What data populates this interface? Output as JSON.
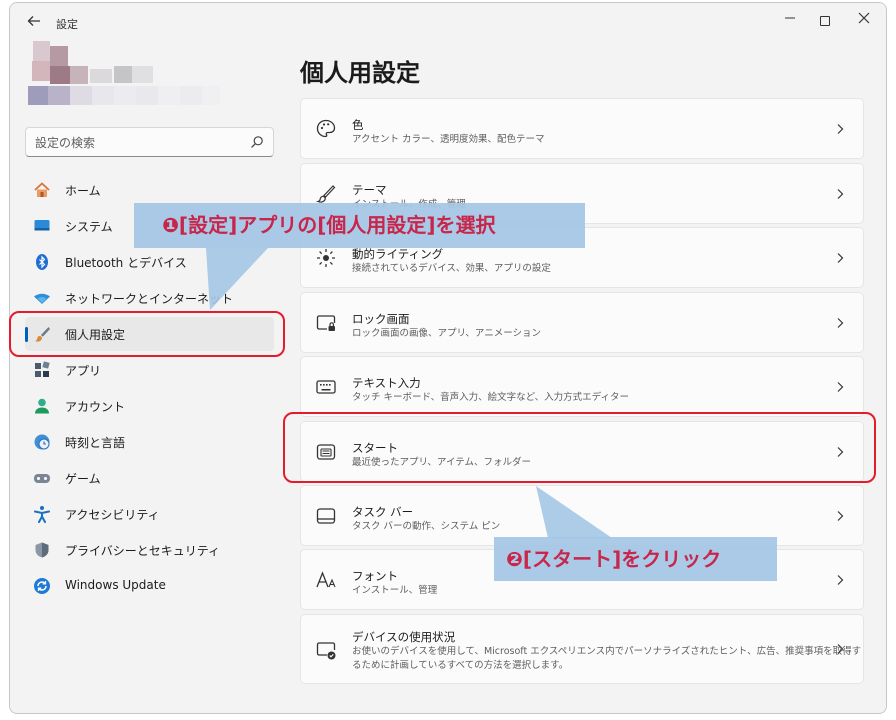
{
  "window": {
    "title": "設定",
    "back_icon": "arrow-left-icon"
  },
  "search": {
    "placeholder": "設定の検索"
  },
  "sidebar": {
    "items": [
      {
        "label": "ホーム",
        "icon": "home-icon"
      },
      {
        "label": "システム",
        "icon": "monitor-icon"
      },
      {
        "label": "Bluetooth とデバイス",
        "icon": "bluetooth-icon"
      },
      {
        "label": "ネットワークとインターネット",
        "icon": "wifi-icon"
      },
      {
        "label": "個人用設定",
        "icon": "paintbrush-icon",
        "selected": true
      },
      {
        "label": "アプリ",
        "icon": "apps-icon"
      },
      {
        "label": "アカウント",
        "icon": "account-icon"
      },
      {
        "label": "時刻と言語",
        "icon": "globe-clock-icon"
      },
      {
        "label": "ゲーム",
        "icon": "gamepad-icon"
      },
      {
        "label": "アクセシビリティ",
        "icon": "accessibility-icon"
      },
      {
        "label": "プライバシーとセキュリティ",
        "icon": "shield-icon"
      },
      {
        "label": "Windows Update",
        "icon": "update-icon"
      }
    ]
  },
  "main": {
    "title": "個人用設定",
    "cards": [
      {
        "title": "色",
        "subtitle": "アクセント カラー、透明度効果、配色テーマ",
        "icon": "palette-icon"
      },
      {
        "title": "テーマ",
        "subtitle": "インストール、作成、管理",
        "icon": "brush-icon"
      },
      {
        "title": "動的ライティング",
        "subtitle": "接続されているデバイス、効果、アプリの設定",
        "icon": "light-icon"
      },
      {
        "title": "ロック画面",
        "subtitle": "ロック画面の画像、アプリ、アニメーション",
        "icon": "lock-screen-icon"
      },
      {
        "title": "テキスト入力",
        "subtitle": "タッチ キーボード、音声入力、絵文字など、入力方式エディター",
        "icon": "keyboard-icon"
      },
      {
        "title": "スタート",
        "subtitle": "最近使ったアプリ、アイテム、フォルダー",
        "icon": "start-icon"
      },
      {
        "title": "タスク バー",
        "subtitle": "タスク バーの動作、システム ピン",
        "icon": "taskbar-icon"
      },
      {
        "title": "フォント",
        "subtitle": "インストール、管理",
        "icon": "font-icon"
      },
      {
        "title": "デバイスの使用状況",
        "subtitle_line1": "お使いのデバイスを使用して、Microsoft エクスペリエンス内でパーソナライズされたヒント、広告、推奨事項を取得す",
        "subtitle_line2": "るために計画しているすべての方法を選択します。",
        "icon": "device-usage-icon"
      }
    ]
  },
  "annotations": {
    "callout1": "❶[設定]アプリの[個人用設定]を選択",
    "callout2": "❷[スタート]をクリック",
    "callout_color": "#a4c6e6",
    "text_color": "#c4143c",
    "frame_color": "#e51a2c"
  },
  "colors": {
    "accent": "#005fb8",
    "window_bg": "#f3f3f3",
    "card_bg": "#fbfbfb"
  }
}
